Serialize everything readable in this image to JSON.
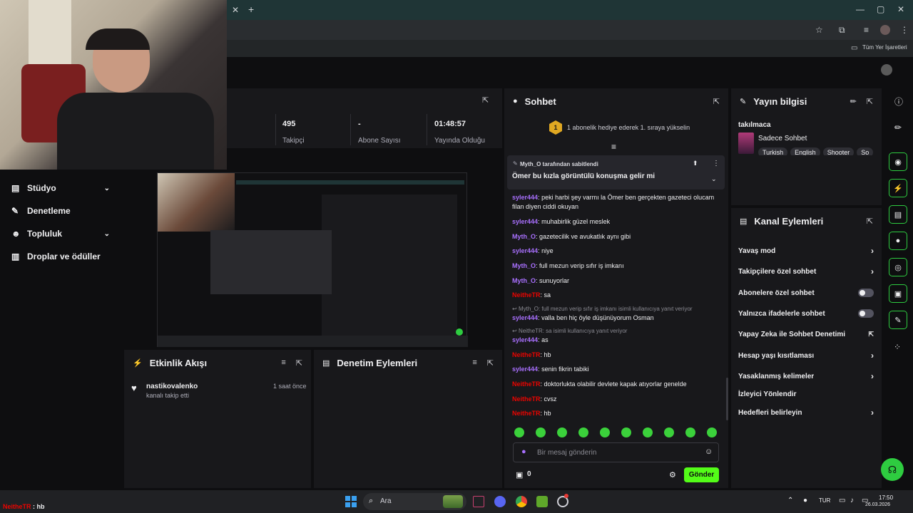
{
  "browser": {
    "bookmarks_label": "Tüm Yer İşaretleri"
  },
  "left_nav": {
    "items": [
      {
        "label": "Stüdyo",
        "icon": "studio-icon",
        "chevron": true
      },
      {
        "label": "Denetleme",
        "icon": "wrench-icon",
        "chevron": false
      },
      {
        "label": "Topluluk",
        "icon": "community-icon",
        "chevron": true
      },
      {
        "label": "Droplar ve ödüller",
        "icon": "drops-icon",
        "chevron": false
      }
    ]
  },
  "stats": [
    {
      "value": "495",
      "label": "Takipçi"
    },
    {
      "value": "-",
      "label": "Abone Sayısı"
    },
    {
      "value": "01:48:57",
      "label": "Yayında Olduğu"
    }
  ],
  "activity_feed": {
    "title": "Etkinlik Akışı",
    "events": [
      {
        "user": "nastikovalenko",
        "action": "kanalı takip etti",
        "time": "1 saat önce"
      }
    ]
  },
  "mod_actions": {
    "title": "Denetim Eylemleri"
  },
  "chat": {
    "title": "Sohbet",
    "gift_prompt_badge": "1",
    "gift_prompt": "1 abonelik hediye ederek 1. sıraya yükselin",
    "pinned_by": "Myth_O tarafından sabitlendi",
    "pinned_message": "Ömer bu kızla görüntülü konuşma gelir mi",
    "lines": [
      {
        "user": "syler444",
        "color": "#a970ff",
        "text": "peki harbi şey varmı la Ömer ben gerçekten gazeteci olucam filan diyen ciddi okuyan"
      },
      {
        "user": "syler444",
        "color": "#a970ff",
        "text": "muhabirlik güzel meslek"
      },
      {
        "user": "Myth_O",
        "color": "#a970ff",
        "text": "gazetecilik ve avukatlık aynı gibi"
      },
      {
        "user": "syler444",
        "color": "#a970ff",
        "text": "niye"
      },
      {
        "user": "Myth_O",
        "color": "#a970ff",
        "text": "full mezun verip sıfır iş imkanı"
      },
      {
        "user": "Myth_O",
        "color": "#a970ff",
        "text": "sunuyorlar"
      },
      {
        "user": "NeitheTR",
        "color": "#eb0400",
        "text": "sa"
      },
      {
        "user": "syler444",
        "color": "#a970ff",
        "text": "valla ben hiç öyle düşünüyorum Osman"
      },
      {
        "user": "syler444",
        "color": "#a970ff",
        "text": "as"
      },
      {
        "user": "NeitheTR",
        "color": "#eb0400",
        "text": "hb"
      },
      {
        "user": "syler444",
        "color": "#a970ff",
        "text": "senin fikrin tabiki"
      },
      {
        "user": "NeitheTR",
        "color": "#eb0400",
        "text": "doktorlukta olabilir devlete kapak atıyorlar genelde"
      },
      {
        "user": "NeitheTR",
        "color": "#eb0400",
        "text": "cvsz"
      },
      {
        "user": "NeitheTR",
        "color": "#eb0400",
        "text": "hb"
      }
    ],
    "replies": [
      "Myth_O: full mezun verip sıfır iş imkanı isimli kullanıcıya yanıt veriyor",
      "NeitheTR: sa isimli kullanıcıya yanıt veriyor"
    ],
    "input_placeholder": "Bir mesaj gönderin",
    "points": "0",
    "send_label": "Gönder"
  },
  "stream_info": {
    "title": "Yayın bilgisi",
    "stream_title": "takılmaca",
    "category": "Sadece Sohbet",
    "tags": [
      "Turkish",
      "English",
      "Shooter",
      "So"
    ]
  },
  "channel_actions": {
    "title": "Kanal Eylemleri",
    "items": [
      {
        "label": "Yavaş mod",
        "control": "chevron"
      },
      {
        "label": "Takipçilere özel sohbet",
        "control": "chevron"
      },
      {
        "label": "Abonelere özel sohbet",
        "control": "toggle"
      },
      {
        "label": "Yalnızca ifadelerle sohbet",
        "control": "toggle"
      },
      {
        "label": "Yapay Zeka ile Sohbet Denetimi",
        "control": "external"
      },
      {
        "label": "Hesap yaşı kısıtlaması",
        "control": "chevron"
      },
      {
        "label": "Yasaklanmış kelimeler",
        "control": "chevron"
      },
      {
        "label": "İzleyici Yönlendir",
        "control": "none"
      },
      {
        "label": "Hedefleri belirleyin",
        "control": "chevron"
      }
    ]
  },
  "overlay_chat": {
    "user": "NeitheTR",
    "text": " : hb"
  },
  "taskbar": {
    "search_label": "Ara",
    "lang": "TUR",
    "time": "17:50",
    "date": "26.03.2026"
  },
  "colors": {
    "accent": "#53fc18",
    "panel": "#18181b",
    "bg": "#0e0e10"
  }
}
